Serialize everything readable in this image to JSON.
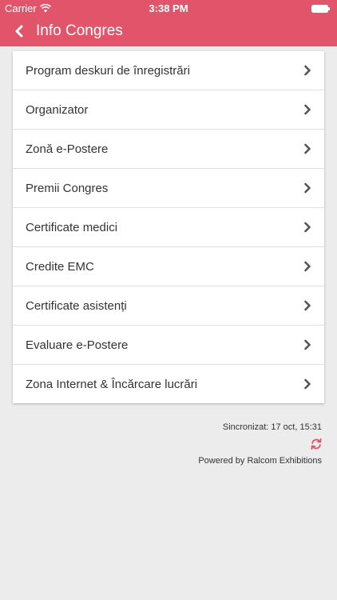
{
  "status_bar": {
    "carrier": "Carrier",
    "time": "3:38 PM"
  },
  "nav": {
    "title": "Info Congres",
    "back_icon": "chevron-left-icon"
  },
  "menu": {
    "items": [
      {
        "label": "Program deskuri de înregistrări"
      },
      {
        "label": "Organizator"
      },
      {
        "label": "Zonă e-Postere"
      },
      {
        "label": "Premii Congres"
      },
      {
        "label": "Certificate medici"
      },
      {
        "label": "Credite EMC"
      },
      {
        "label": "Certificate asistenți"
      },
      {
        "label": "Evaluare e-Postere"
      },
      {
        "label": "Zona Internet & Încărcare lucrări"
      }
    ]
  },
  "footer": {
    "sync_text": "Sincronizat: 17 oct, 15:31",
    "powered_by": "Powered by Ralcom Exhibitions",
    "refresh_icon": "refresh-icon"
  },
  "colors": {
    "accent": "#e2546a",
    "background": "#ececec",
    "card": "#ffffff"
  }
}
